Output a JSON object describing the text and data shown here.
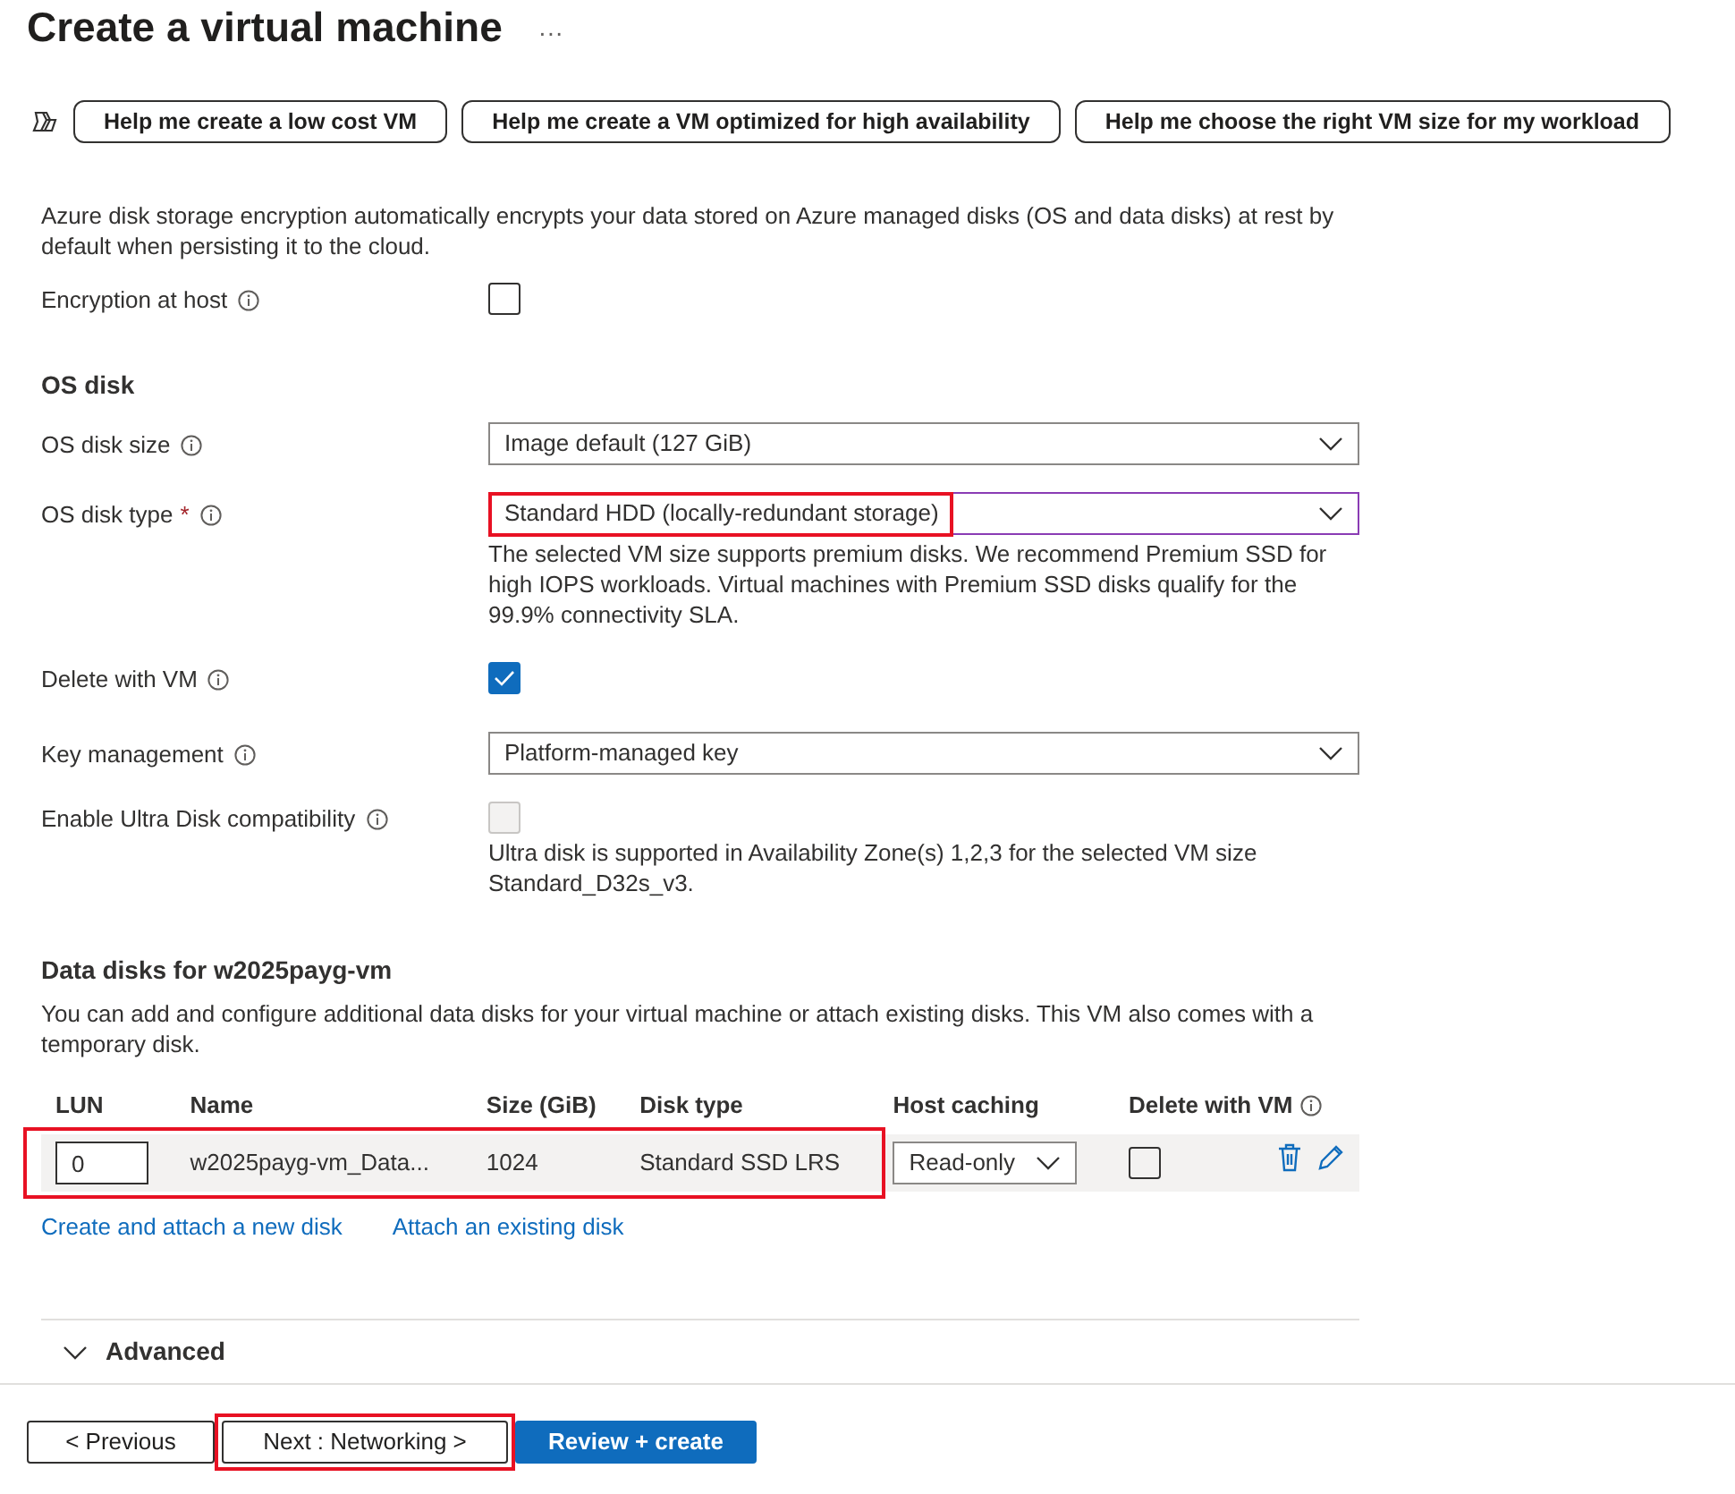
{
  "title": "Create a virtual machine",
  "more": "···",
  "help_buttons": [
    "Help me create a low cost VM",
    "Help me create a VM optimized for high availability",
    "Help me choose the right VM size for my workload"
  ],
  "form": [
    {
      "kind": "paragraph",
      "text": "Azure disk storage encryption automatically encrypts your data stored on Azure managed disks (OS and data disks) at rest by default when persisting it to the cloud."
    },
    {
      "kind": "checkbox",
      "label": "Encryption at host",
      "checked": false,
      "disabled": false
    },
    {
      "kind": "heading",
      "text": "OS disk"
    },
    {
      "kind": "select",
      "label": "OS disk size",
      "value": "Image default (127 GiB)",
      "focused": false,
      "highlighted": false
    },
    {
      "kind": "select",
      "label": "OS disk type",
      "required_mark": "*",
      "value": "Standard HDD (locally-redundant storage)",
      "focused": true,
      "highlighted": true,
      "note": "The selected VM size supports premium disks. We recommend Premium SSD for high IOPS workloads. Virtual machines with Premium SSD disks qualify for the 99.9% connectivity SLA."
    },
    {
      "kind": "checkbox",
      "label": "Delete with VM",
      "checked": true,
      "disabled": false
    },
    {
      "kind": "select",
      "label": "Key management",
      "value": "Platform-managed key",
      "focused": false,
      "highlighted": false
    },
    {
      "kind": "checkbox",
      "label": "Enable Ultra Disk compatibility",
      "checked": false,
      "disabled": true,
      "note": "Ultra disk is supported in Availability Zone(s) 1,2,3 for the selected VM size Standard_D32s_v3."
    }
  ],
  "data_disks": {
    "heading": "Data disks for w2025payg-vm",
    "description": "You can add and configure additional data disks for your virtual machine or attach existing disks. This VM also comes with a temporary disk.",
    "columns": [
      "LUN",
      "Name",
      "Size (GiB)",
      "Disk type",
      "Host caching",
      "Delete with VM"
    ],
    "rows": [
      {
        "lun": "0",
        "name": "w2025payg-vm_Data...",
        "size": "1024",
        "disk_type": "Standard SSD LRS",
        "host_caching": "Read-only",
        "delete_with_vm": false,
        "highlighted": true
      }
    ],
    "links": [
      "Create and attach a new disk",
      "Attach an existing disk"
    ]
  },
  "advanced": {
    "label": "Advanced",
    "expanded": false
  },
  "footer_buttons": [
    {
      "label": "< Previous",
      "kind": "secondary",
      "highlighted": false
    },
    {
      "label": "Next : Networking >",
      "kind": "secondary",
      "highlighted": true
    },
    {
      "label": "Review + create",
      "kind": "primary",
      "highlighted": false
    }
  ]
}
